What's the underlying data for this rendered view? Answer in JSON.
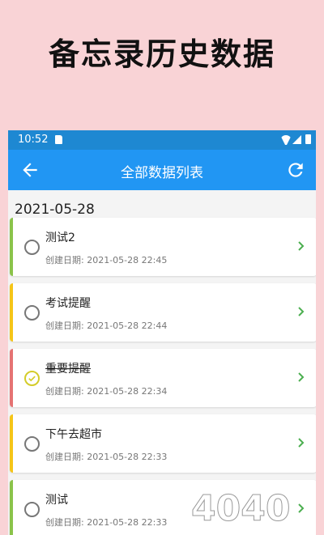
{
  "promo": {
    "title": "备忘录历史数据"
  },
  "status_bar": {
    "time": "10:52"
  },
  "app_bar": {
    "title": "全部数据列表",
    "back_icon": "arrow-back-icon",
    "refresh_icon": "refresh-icon"
  },
  "list": {
    "date_header": "2021-05-28",
    "items": [
      {
        "title": "测试2",
        "date": "创建日期:  2021-05-28 22:45",
        "accent": "#8bc34a",
        "checked": false
      },
      {
        "title": "考试提醒",
        "date": "创建日期:  2021-05-28 22:44",
        "accent": "#f5c518",
        "checked": false
      },
      {
        "title": "重要提醒",
        "date": "创建日期:  2021-05-28 22:34",
        "accent": "#e57373",
        "checked": true
      },
      {
        "title": "下午去超市",
        "date": "创建日期:  2021-05-28 22:33",
        "accent": "#f5c518",
        "checked": false
      },
      {
        "title": " 测试",
        "date": "创建日期:  2021-05-28 22:33",
        "accent": "#8bc34a",
        "checked": false
      }
    ]
  },
  "watermark": {
    "text": "4040"
  },
  "colors": {
    "primary": "#2196f3",
    "status": "#1e88d2",
    "background": "#f9d3d6",
    "chevron": "#4caf50"
  }
}
